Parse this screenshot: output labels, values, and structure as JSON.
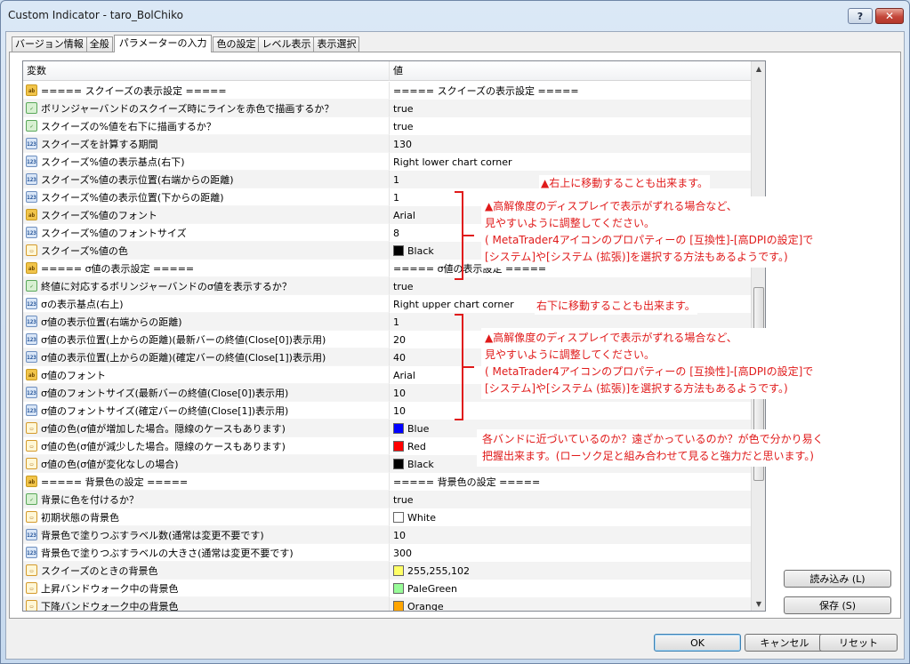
{
  "window": {
    "title": "Custom Indicator - taro_BolChiko",
    "help_label": "?",
    "close_label": "✕"
  },
  "tabs": [
    {
      "label": "バージョン情報",
      "active": false
    },
    {
      "label": "全般",
      "active": false
    },
    {
      "label": "パラメーターの入力",
      "active": true
    },
    {
      "label": "色の設定",
      "active": false
    },
    {
      "label": "レベル表示",
      "active": false
    },
    {
      "label": "表示選択",
      "active": false
    }
  ],
  "grid": {
    "headers": {
      "variable": "変数",
      "value": "値"
    },
    "rows": [
      {
        "type": "str",
        "name": "===== スクイーズの表示設定 =====",
        "value": "===== スクイーズの表示設定 ====="
      },
      {
        "type": "bool",
        "name": "ボリンジャーバンドのスクイーズ時にラインを赤色で描画するか？",
        "value": "true"
      },
      {
        "type": "bool",
        "name": "スクイーズの%値を右下に描画するか？",
        "value": "true"
      },
      {
        "type": "int",
        "name": "スクイーズを計算する期間",
        "value": "130"
      },
      {
        "type": "int",
        "name": "スクイーズ%値の表示基点(右下)",
        "value": "Right lower chart corner"
      },
      {
        "type": "int",
        "name": "スクイーズ%値の表示位置(右端からの距離)",
        "value": "1"
      },
      {
        "type": "int",
        "name": "スクイーズ%値の表示位置(下からの距離)",
        "value": "1"
      },
      {
        "type": "str",
        "name": "スクイーズ%値のフォント",
        "value": "Arial"
      },
      {
        "type": "int",
        "name": "スクイーズ%値のフォントサイズ",
        "value": "8"
      },
      {
        "type": "color",
        "name": "スクイーズ%値の色",
        "value": "Black",
        "swatch": "#000000"
      },
      {
        "type": "str",
        "name": "===== σ値の表示設定 =====",
        "value": "===== σ値の表示設定 ====="
      },
      {
        "type": "bool",
        "name": "終値に対応するボリンジャーバンドのσ値を表示するか？",
        "value": "true"
      },
      {
        "type": "int",
        "name": "σの表示基点(右上)",
        "value": "Right upper chart corner"
      },
      {
        "type": "int",
        "name": "σ値の表示位置(右端からの距離)",
        "value": "1"
      },
      {
        "type": "int",
        "name": "σ値の表示位置(上からの距離)(最新バーの終値(Close[0])表示用)",
        "value": "20"
      },
      {
        "type": "int",
        "name": "σ値の表示位置(上からの距離)(確定バーの終値(Close[1])表示用)",
        "value": "40"
      },
      {
        "type": "str",
        "name": "σ値のフォント",
        "value": "Arial"
      },
      {
        "type": "int",
        "name": "σ値のフォントサイズ(最新バーの終値(Close[0])表示用)",
        "value": "10"
      },
      {
        "type": "int",
        "name": "σ値のフォントサイズ(確定バーの終値(Close[1])表示用)",
        "value": "10"
      },
      {
        "type": "color",
        "name": "σ値の色(σ値が増加した場合。隠線のケースもあります)",
        "value": "Blue",
        "swatch": "#0000ff"
      },
      {
        "type": "color",
        "name": "σ値の色(σ値が減少した場合。隠線のケースもあります)",
        "value": "Red",
        "swatch": "#ff0000"
      },
      {
        "type": "color",
        "name": "σ値の色(σ値が変化なしの場合)",
        "value": "Black",
        "swatch": "#000000"
      },
      {
        "type": "str",
        "name": "===== 背景色の設定 =====",
        "value": "===== 背景色の設定 ====="
      },
      {
        "type": "bool",
        "name": "背景に色を付けるか？",
        "value": "true"
      },
      {
        "type": "color",
        "name": "初期状態の背景色",
        "value": "White",
        "swatch": "#ffffff"
      },
      {
        "type": "int",
        "name": "背景色で塗りつぶすラベル数(通常は変更不要です)",
        "value": "10"
      },
      {
        "type": "int",
        "name": "背景色で塗りつぶすラベルの大きさ(通常は変更不要です)",
        "value": "300"
      },
      {
        "type": "color",
        "name": "スクイーズのときの背景色",
        "value": "255,255,102",
        "swatch": "#ffff66"
      },
      {
        "type": "color",
        "name": "上昇バンドウォーク中の背景色",
        "value": "PaleGreen",
        "swatch": "#98fb98"
      },
      {
        "type": "color",
        "name": "下降バンドウォーク中の背景色",
        "value": "Orange",
        "swatch": "#ffa500"
      }
    ]
  },
  "icons": {
    "str": "ab",
    "int": "123",
    "bool": "✓",
    "color": "▭"
  },
  "side_buttons": {
    "load": "読み込み (L)",
    "save": "保存 (S)"
  },
  "bottom_buttons": {
    "ok": "OK",
    "cancel": "キャンセル",
    "reset": "リセット"
  },
  "annotations": {
    "note1": "▲右上に移動することも出来ます。",
    "note2": [
      "▲高解像度のディスプレイで表示がずれる場合など、",
      "見やすいように調整してください。",
      "( MetaTrader4アイコンのプロパティーの [互換性]-[高DPIの設定]で",
      "[システム]や[システム (拡張)]を選択する方法もあるようです。)"
    ],
    "note3": "右下に移動することも出来ます。",
    "note4": [
      "▲高解像度のディスプレイで表示がずれる場合など、",
      "見やすいように調整してください。",
      "( MetaTrader4アイコンのプロパティーの [互換性]-[高DPIの設定]で",
      "[システム]や[システム (拡張)]を選択する方法もあるようです。)"
    ],
    "note5": [
      "各バンドに近づいているのか？遠ざかっているのか？が色で分かり易く",
      "把握出来ます。(ローソク足と組み合わせて見ると強力だと思います。)"
    ]
  },
  "colors": {
    "annotation": "#e01a1a"
  }
}
